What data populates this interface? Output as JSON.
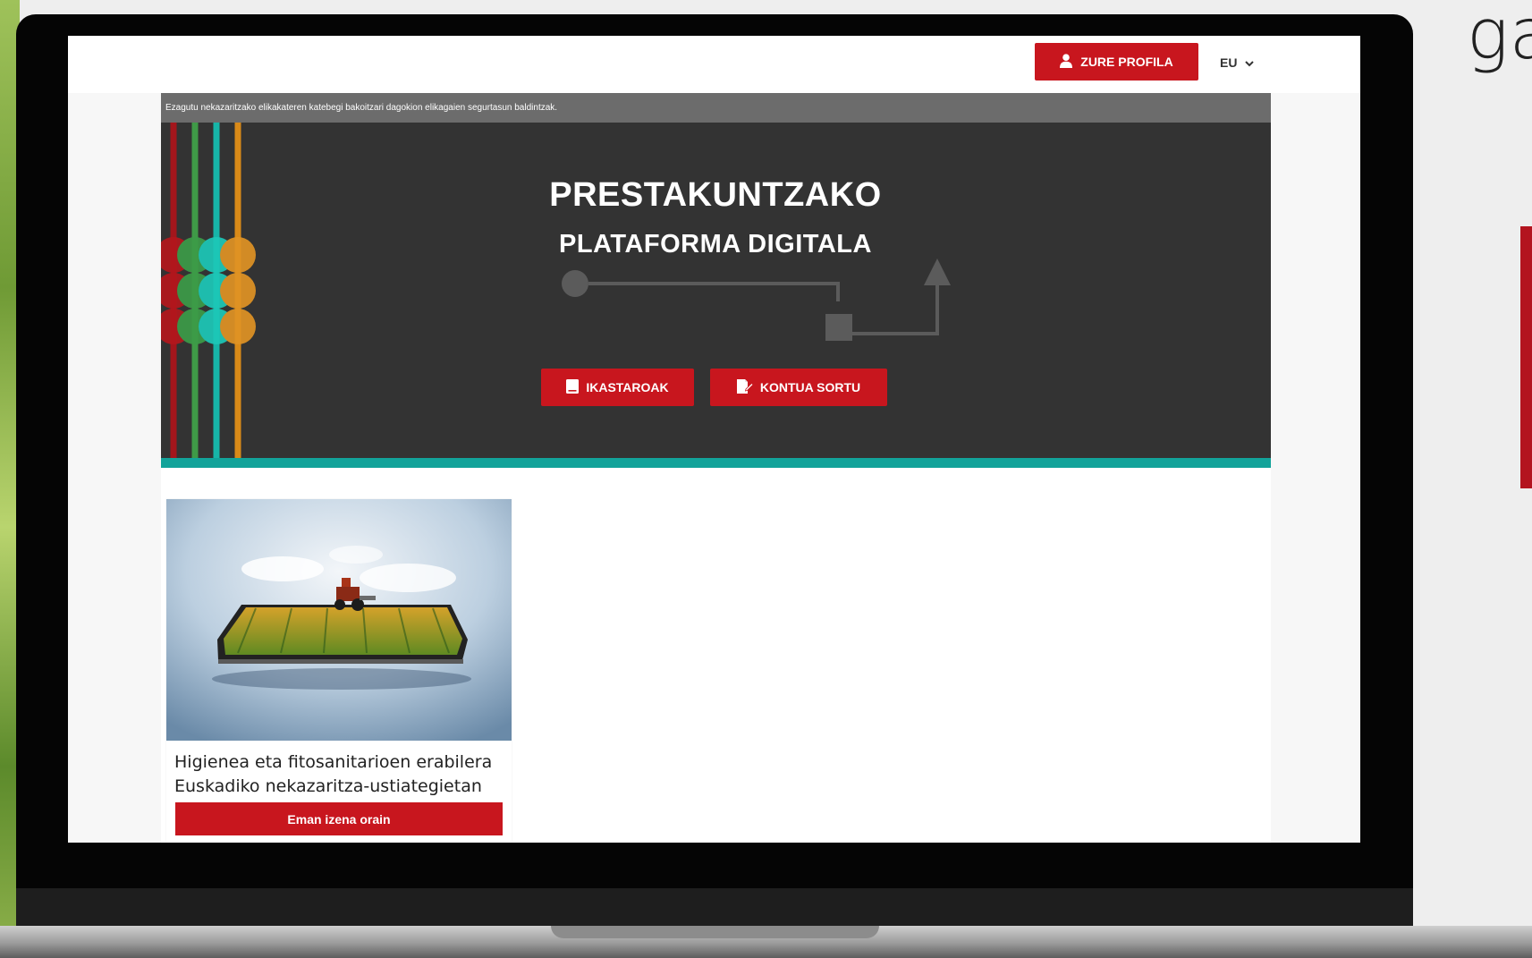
{
  "marketing": {
    "corner_text": "ga"
  },
  "topbar": {
    "profile_button": "ZURE PROFILA",
    "language": "EU"
  },
  "notice": "Ezagutu nekazaritzako elikakateren katebegi bakoitzari dagokion elikagaien segurtasun baldintzak.",
  "hero": {
    "title": "PRESTAKUNTZAKO",
    "subtitle": "PLATAFORMA DIGITALA",
    "courses_button": "IKASTAROAK",
    "create_account_button": "KONTUA SORTU"
  },
  "courses": [
    {
      "title": "Higienea eta fitosanitarioen erabilera Euskadiko nekazaritza-ustiategietan",
      "cta": "Eman izena orain"
    }
  ],
  "colors": {
    "brand_red": "#c8161e",
    "hero_bg": "#333333",
    "accent_teal": "#12a39a",
    "notice_bg": "#6c6c6c"
  },
  "icons": {
    "profile": "user-icon",
    "language": "chevron-down-icon",
    "courses": "book-icon",
    "create_account": "edit-icon"
  }
}
